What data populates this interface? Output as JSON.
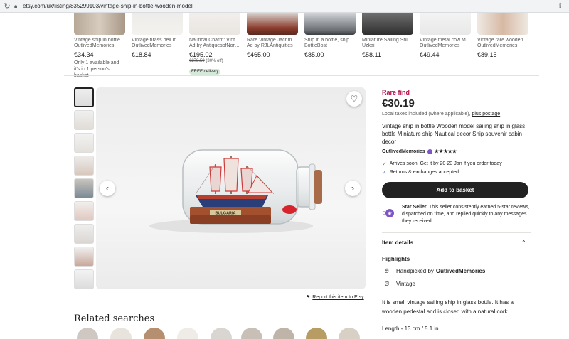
{
  "browser": {
    "url": "etsy.com/uk/listing/835299103/vintage-ship-in-bottle-wooden-model"
  },
  "carousel": [
    {
      "title": "Vintage ship in bottle ...",
      "shop": "OutlivedMemories",
      "price": "€34.34",
      "note": "Only 1 available and it's in 1 person's basket"
    },
    {
      "title": "Vintage brass bell Indi...",
      "shop": "OutlivedMemories",
      "price": "€18.84"
    },
    {
      "title": "Nautical Charm: Vinta...",
      "shop": "Ad by AntiquesofNorwa",
      "price": "€195.02",
      "original": "€278.59",
      "discount": "(30% off)",
      "badge": "FREE delivery"
    },
    {
      "title": "Rare Vintage Jacrim K...",
      "shop": "Ad by RJLAntiquities",
      "price": "€465.00"
    },
    {
      "title": "Ship in a bottle, ship i...",
      "shop": "BottleBost",
      "price": "€85.00"
    },
    {
      "title": "Miniature Sailing Ship...",
      "shop": "Uzkai",
      "price": "€58.11"
    },
    {
      "title": "Vintage metal cow Mi...",
      "shop": "OutlivedMemories",
      "price": "€49.44"
    },
    {
      "title": "Vintage rare wooden ...",
      "shop": "OutlivedMemories",
      "price": "€89.15"
    }
  ],
  "gallery": {
    "thumb_count": 9,
    "report_label": "Report this item to Etsy"
  },
  "related": {
    "heading": "Related searches"
  },
  "product": {
    "rare_label": "Rare find",
    "price": "€30.19",
    "tax_text": "Local taxes included (where applicable),",
    "tax_link": "plus postage",
    "title": "Vintage ship in bottle Wooden model sailing ship in glass bottle Miniature ship Nautical decor Ship souvenir cabin decor",
    "shop_name": "OutlivedMemories",
    "stars": "★★★★★",
    "arrival_prefix": "Arrives soon! Get it by",
    "arrival_dates": "20-23 Jan",
    "arrival_suffix": "if you order today",
    "returns": "Returns & exchanges accepted",
    "basket_label": "Add to basket",
    "star_seller_bold": "Star Seller.",
    "star_seller_text": "This seller consistently earned 5-star reviews, dispatched on time, and replied quickly to any messages they received.",
    "item_details": "Item details",
    "highlights": "Highlights",
    "handpicked_prefix": "Handpicked by",
    "handpicked_shop": "OutlivedMemories",
    "vintage": "Vintage",
    "description": "It is small vintage sailing ship in glass bottle. It has a wooden pedestal and is closed with a natural cork.",
    "length": "Length - 13 cm / 5.1 in."
  },
  "colors": {
    "rare": "#b3124b",
    "button": "#222222",
    "check": "#3b67d9",
    "star_seller": "#7e55c7"
  }
}
